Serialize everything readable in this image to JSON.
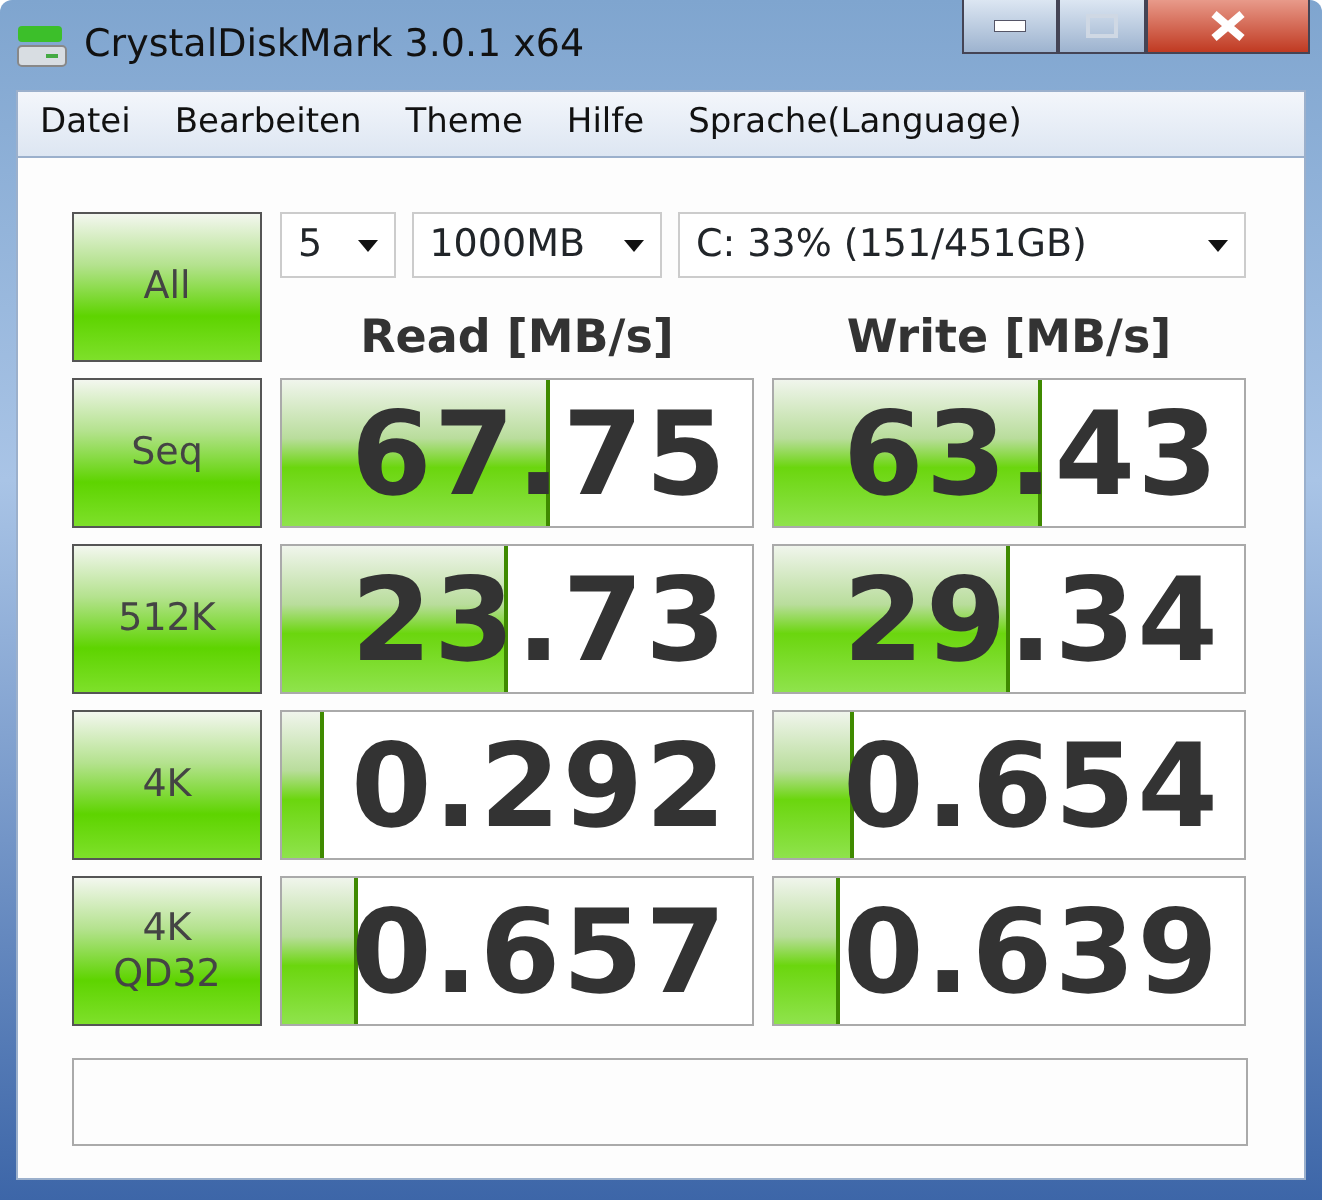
{
  "window": {
    "title": "CrystalDiskMark 3.0.1 x64"
  },
  "menu": [
    "Datei",
    "Bearbeiten",
    "Theme",
    "Hilfe",
    "Sprache(Language)"
  ],
  "all_button": "All",
  "selects": [
    {
      "value": "5",
      "kind": "narrow"
    },
    {
      "value": "1000MB",
      "kind": "medium"
    },
    {
      "value": "C: 33% (151/451GB)",
      "kind": "wide"
    }
  ],
  "columns": [
    "Read [MB/s]",
    "Write [MB/s]"
  ],
  "rows": [
    {
      "label": "Seq",
      "results": [
        {
          "value": "67.75",
          "level": 0.57
        },
        {
          "value": "63.43",
          "level": 0.57
        }
      ]
    },
    {
      "label": "512K",
      "results": [
        {
          "value": "23.73",
          "level": 0.48
        },
        {
          "value": "29.34",
          "level": 0.5
        }
      ]
    },
    {
      "label": "4K",
      "results": [
        {
          "value": "0.292",
          "level": 0.09
        },
        {
          "value": "0.654",
          "level": 0.17
        }
      ]
    },
    {
      "label": "4K\nQD32",
      "results": [
        {
          "value": "0.657",
          "level": 0.16
        },
        {
          "value": "0.639",
          "level": 0.14
        }
      ]
    }
  ]
}
